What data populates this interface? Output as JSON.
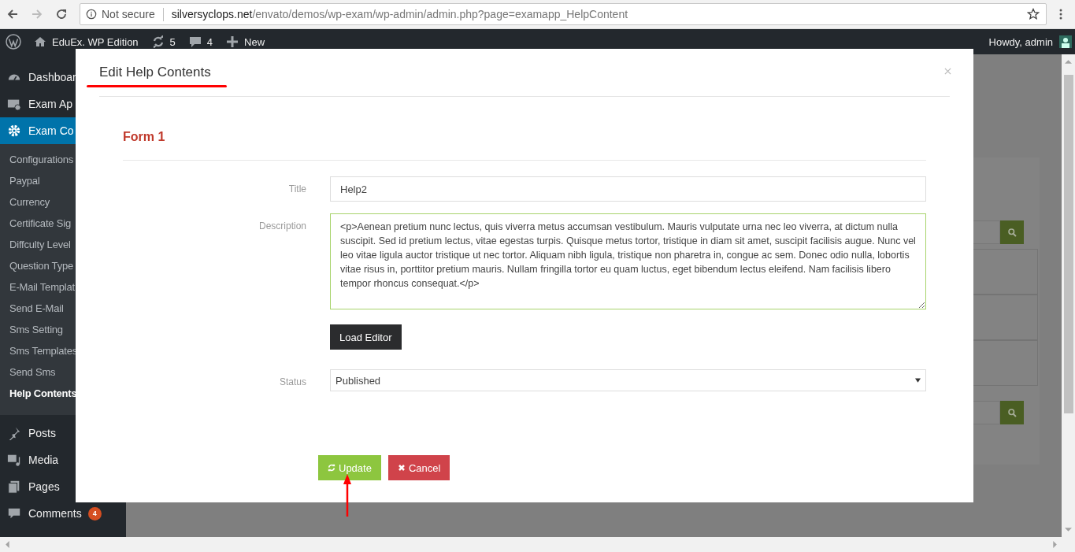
{
  "browser": {
    "forward": {
      "disabled": true
    },
    "security_label": "Not secure",
    "url_host": "silversyclops.net",
    "url_path": "/envato/demos/wp-exam/wp-admin/admin.php?page=examapp_HelpContent"
  },
  "admin_bar": {
    "site_name": "EduEx. WP Edition",
    "updates_count": "5",
    "comments_count": "4",
    "new_label": "New",
    "greeting": "Howdy, admin"
  },
  "sidebar": {
    "items": [
      {
        "label": "Dashboar",
        "selected": false
      },
      {
        "label": "Exam Ap",
        "selected": false
      },
      {
        "label": "Exam Co",
        "selected": true,
        "children": [
          {
            "label": "Configurations",
            "selected": false
          },
          {
            "label": "Paypal",
            "selected": false
          },
          {
            "label": "Currency",
            "selected": false
          },
          {
            "label": "Certificate Sig",
            "selected": false
          },
          {
            "label": "Diffculty Level",
            "selected": false
          },
          {
            "label": "Question Type",
            "selected": false
          },
          {
            "label": "E-Mail Templat",
            "selected": false
          },
          {
            "label": "Send E-Mail",
            "selected": false
          },
          {
            "label": "Sms Setting",
            "selected": false
          },
          {
            "label": "Sms Templates",
            "selected": false
          },
          {
            "label": "Send Sms",
            "selected": false
          },
          {
            "label": "Help Contents",
            "selected": true
          }
        ]
      },
      {
        "label": "Posts",
        "selected": false
      },
      {
        "label": "Media",
        "selected": false
      },
      {
        "label": "Pages",
        "selected": false
      },
      {
        "label": "Comments",
        "selected": false,
        "badge": "4"
      }
    ]
  },
  "modal": {
    "title": "Edit Help Contents",
    "section_title": "Form 1",
    "fields": [
      {
        "kind": "text",
        "label": "Title",
        "value": "Help2"
      },
      {
        "kind": "textarea",
        "label": "Description",
        "value": "<p>Aenean pretium nunc lectus, quis viverra metus accumsan vestibulum. Mauris vulputate urna nec leo viverra, at dictum nulla suscipit. Sed id pretium lectus, vitae egestas turpis. Quisque metus tortor, tristique in diam sit amet, suscipit facilisis augue. Nunc vel leo vitae ligula auctor tristique ut nec tortor. Aliquam nibh ligula, tristique non pharetra in, congue ac sem. Donec odio nulla, lobortis vitae risus in, porttitor pretium mauris. Nullam fringilla tortor eu quam luctus, eget bibendum lectus eleifend. Nam facilisis libero tempor rhoncus consequat.</p>",
        "action": "Load Editor"
      },
      {
        "kind": "select",
        "label": "Status",
        "value": "Published"
      }
    ],
    "buttons": [
      {
        "kind": "primary",
        "label": "Update"
      },
      {
        "kind": "danger",
        "label": "Cancel"
      }
    ]
  }
}
